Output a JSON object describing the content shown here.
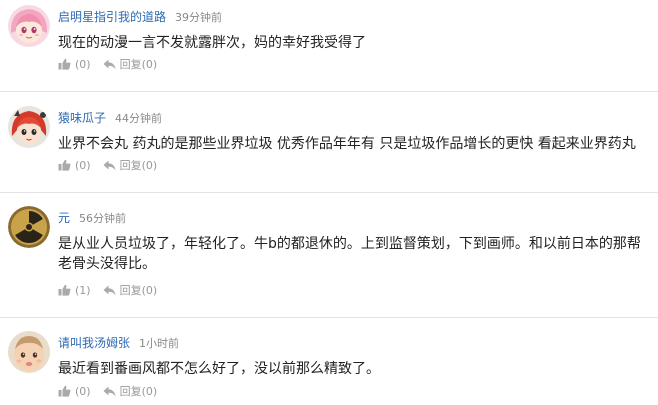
{
  "comments": [
    {
      "username": "启明星指引我的道路",
      "time": "39分钟前",
      "text": "现在的动漫一言不发就露胖次，妈的幸好我受得了",
      "like_count": "(0)",
      "reply_label": "回复",
      "reply_count": "(0)",
      "avatar": "pink-hair-anime-girl"
    },
    {
      "username": "猿味瓜子",
      "time": "44分钟前",
      "text": "业界不会丸 药丸的是那些业界垃圾 优秀作品年年有 只是垃圾作品增长的更快 看起来业界药丸",
      "like_count": "(0)",
      "reply_label": "回复",
      "reply_count": "(0)",
      "avatar": "red-hair-anime-character"
    },
    {
      "username": "元",
      "time": "56分钟前",
      "text": "是从业人员垃圾了，年轻化了。牛b的都退休的。上到监督策划，下到画师。和以前日本的那帮老骨头没得比。",
      "like_count": "(1)",
      "reply_label": "回复",
      "reply_count": "(0)",
      "avatar": "radiation-symbol"
    },
    {
      "username": "请叫我汤姆张",
      "time": "1小时前",
      "text": "最近看到番画风都不怎么好了，没以前那么精致了。",
      "like_count": "(0)",
      "reply_label": "回复",
      "reply_count": "(0)",
      "avatar": "baby-photo"
    }
  ],
  "colors": {
    "username": "#2e6ab3",
    "time": "#888888",
    "text": "#222222",
    "action": "#999999",
    "divider": "#e3e3e3"
  }
}
